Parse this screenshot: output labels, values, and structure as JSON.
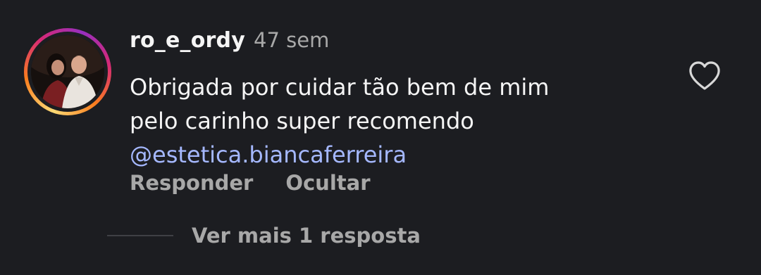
{
  "comment": {
    "username": "ro_e_ordy",
    "timestamp": "47 sem",
    "text_line_1": "Obrigada por cuidar tão bem de mim",
    "text_line_2": "pelo carinho super recomendo",
    "mention": "@estetica.biancaferreira"
  },
  "actions": {
    "reply_label": "Responder",
    "hide_label": "Ocultar"
  },
  "replies": {
    "view_more_label": "Ver mais 1 resposta"
  },
  "icons": {
    "like": "heart-outline-icon",
    "avatar_ring": "story-ring"
  },
  "colors": {
    "background": "#1c1d21",
    "primary_text": "#f5f5f5",
    "secondary_text": "#a8a8a8",
    "mention": "#a5b8ff"
  }
}
